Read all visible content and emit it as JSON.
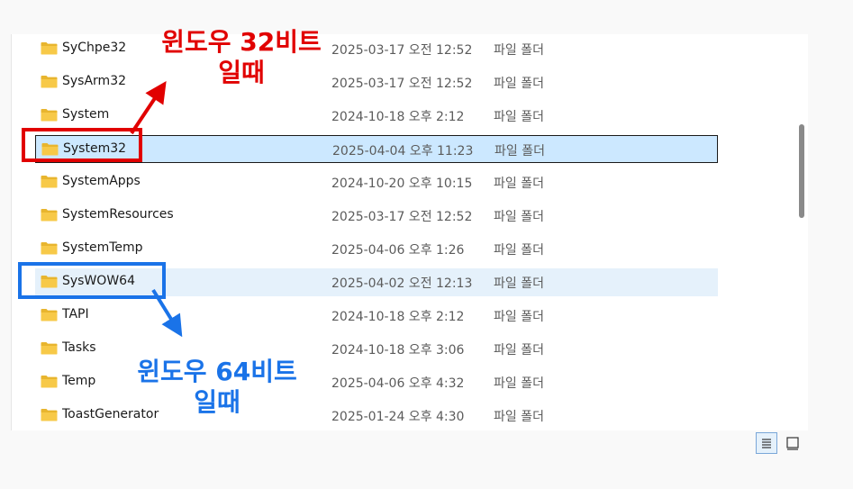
{
  "files": [
    {
      "name": "SyChpe32",
      "date": "2025-03-17 오전 12:52",
      "type": "파일 폴더"
    },
    {
      "name": "SysArm32",
      "date": "2025-03-17 오전 12:52",
      "type": "파일 폴더"
    },
    {
      "name": "System",
      "date": "2024-10-18 오후 2:12",
      "type": "파일 폴더"
    },
    {
      "name": "System32",
      "date": "2025-04-04 오후 11:23",
      "type": "파일 폴더"
    },
    {
      "name": "SystemApps",
      "date": "2024-10-20 오후 10:15",
      "type": "파일 폴더"
    },
    {
      "name": "SystemResources",
      "date": "2025-03-17 오전 12:52",
      "type": "파일 폴더"
    },
    {
      "name": "SystemTemp",
      "date": "2025-04-06 오후 1:26",
      "type": "파일 폴더"
    },
    {
      "name": "SysWOW64",
      "date": "2025-04-02 오전 12:13",
      "type": "파일 폴더"
    },
    {
      "name": "TAPI",
      "date": "2024-10-18 오후 2:12",
      "type": "파일 폴더"
    },
    {
      "name": "Tasks",
      "date": "2024-10-18 오후 3:06",
      "type": "파일 폴더"
    },
    {
      "name": "Temp",
      "date": "2025-04-06 오후 4:32",
      "type": "파일 폴더"
    },
    {
      "name": "ToastGenerator",
      "date": "2025-01-24 오후 4:30",
      "type": "파일 폴더"
    }
  ],
  "selected_index": 3,
  "hover_index": 7,
  "annotations": {
    "red_line1": "윈도우 32비트",
    "red_line2": "일때",
    "blue_line1": "윈도우 64비트",
    "blue_line2": "일때"
  },
  "colors": {
    "red": "#e10000",
    "blue": "#1a73e8",
    "folder": "#f7c948"
  }
}
